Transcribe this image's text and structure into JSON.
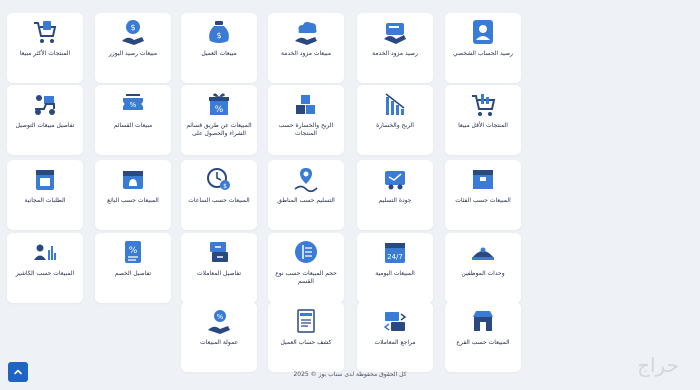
{
  "tiles": [
    {
      "label": "رصيد الحساب الشخصي",
      "icon": "user-account-icon"
    },
    {
      "label": "رصيد مزود الخدمة",
      "icon": "wallet-card-icon"
    },
    {
      "label": "مبيعات مزود الخدمة",
      "icon": "cloud-hand-icon"
    },
    {
      "label": "مبيعات العميل",
      "icon": "money-bag-icon"
    },
    {
      "label": "مبيعات رصيد اليوزر",
      "icon": "dollar-hand-icon"
    },
    {
      "label": "المنتجات الأكثر مبيعا",
      "icon": "cart-bag-icon"
    },
    {
      "label": "المنتجات الأقل مبيعا",
      "icon": "cart-chart-icon"
    },
    {
      "label": "الربح والخسارة",
      "icon": "bar-down-icon"
    },
    {
      "label": "الربح والخسارة حسب المنتجات",
      "icon": "boxes-icon"
    },
    {
      "label": "المبيعات عن طريق قسائم الشراء والحصول على",
      "icon": "gift-percent-icon"
    },
    {
      "label": "مبيعات القسائم",
      "icon": "coupon-icon"
    },
    {
      "label": "تفاصيل مبيعات التوصيل",
      "icon": "delivery-scooter-icon"
    },
    {
      "label": "المبيعات حسب الفئات",
      "icon": "products-box-icon"
    },
    {
      "label": "جودة التسليم",
      "icon": "delivery-truck-icon"
    },
    {
      "label": "التسليم حسب المناطق",
      "icon": "route-pin-icon"
    },
    {
      "label": "المبيعات حسب الساعات",
      "icon": "clock-dollar-icon"
    },
    {
      "label": "المبيعات حسب البائع",
      "icon": "bell-calendar-icon"
    },
    {
      "label": "الطلبات المجانية",
      "icon": "store-calendar-icon"
    },
    {
      "label": "وحدات الموظفين",
      "icon": "staff-dashboard-icon"
    },
    {
      "label": "المبيعات اليومية",
      "icon": "calendar-247-icon"
    },
    {
      "label": "حجم المبيعات حسب نوع القسم",
      "icon": "speed-circle-icon"
    },
    {
      "label": "تفاصيل المعاملات",
      "icon": "transactions-icon"
    },
    {
      "label": "تفاصيل الخصم",
      "icon": "discount-doc-icon"
    },
    {
      "label": "المبيعات حسب الكاشير",
      "icon": "cashier-chart-icon"
    },
    {
      "label": "المبيعات حسب الفرع",
      "icon": "branch-store-icon"
    },
    {
      "label": "مراجع المعاملات",
      "icon": "exchange-icon"
    },
    {
      "label": "كشف حساب العميل",
      "icon": "statement-doc-icon"
    },
    {
      "label": "عمولة المبيعات",
      "icon": "commission-hand-icon"
    }
  ],
  "footer": {
    "text": "كل الحقوق محفوظة لدى سناب بوز © 2025"
  },
  "watermark": {
    "text": "حراج"
  },
  "colors": {
    "accent": "#1d64c4",
    "icon_dark": "#2a4a7f",
    "icon_light": "#3a7bd5",
    "background": "#eef1f5"
  }
}
